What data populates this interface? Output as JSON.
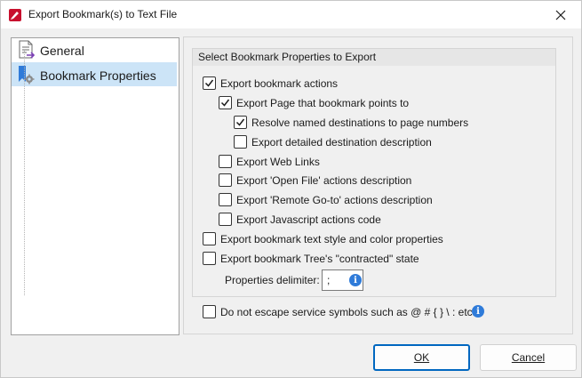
{
  "window": {
    "title": "Export Bookmark(s) to Text File"
  },
  "nav": {
    "items": [
      {
        "label": "General",
        "icon": "general-page-icon",
        "selected": false
      },
      {
        "label": "Bookmark Properties",
        "icon": "bookmark-properties-icon",
        "selected": true
      }
    ]
  },
  "group": {
    "title": "Select Bookmark Properties to Export"
  },
  "options": {
    "export_bookmark_actions": {
      "label": "Export bookmark actions",
      "checked": true
    },
    "export_page": {
      "label": "Export Page that bookmark points to",
      "checked": true
    },
    "resolve_named": {
      "label": "Resolve named destinations to page numbers",
      "checked": true
    },
    "export_detailed": {
      "label": "Export detailed destination description",
      "checked": false
    },
    "export_web_links": {
      "label": "Export Web Links",
      "checked": false
    },
    "export_open_file": {
      "label": "Export 'Open File' actions description",
      "checked": false
    },
    "export_remote_goto": {
      "label": "Export 'Remote Go-to' actions description",
      "checked": false
    },
    "export_javascript": {
      "label": "Export Javascript actions code",
      "checked": false
    },
    "export_text_style": {
      "label": "Export bookmark text style and color properties",
      "checked": false
    },
    "export_contracted": {
      "label": "Export bookmark Tree's \"contracted\" state",
      "checked": false
    },
    "do_not_escape": {
      "label": "Do not escape service symbols such as @ # { } \\ : etc.",
      "checked": false
    }
  },
  "delimiter": {
    "label": "Properties delimiter:",
    "value": ";"
  },
  "buttons": {
    "ok": "OK",
    "cancel": "Cancel"
  },
  "colors": {
    "accent": "#0067c0",
    "selection": "#cce4f7",
    "info": "#2f7bd9"
  }
}
